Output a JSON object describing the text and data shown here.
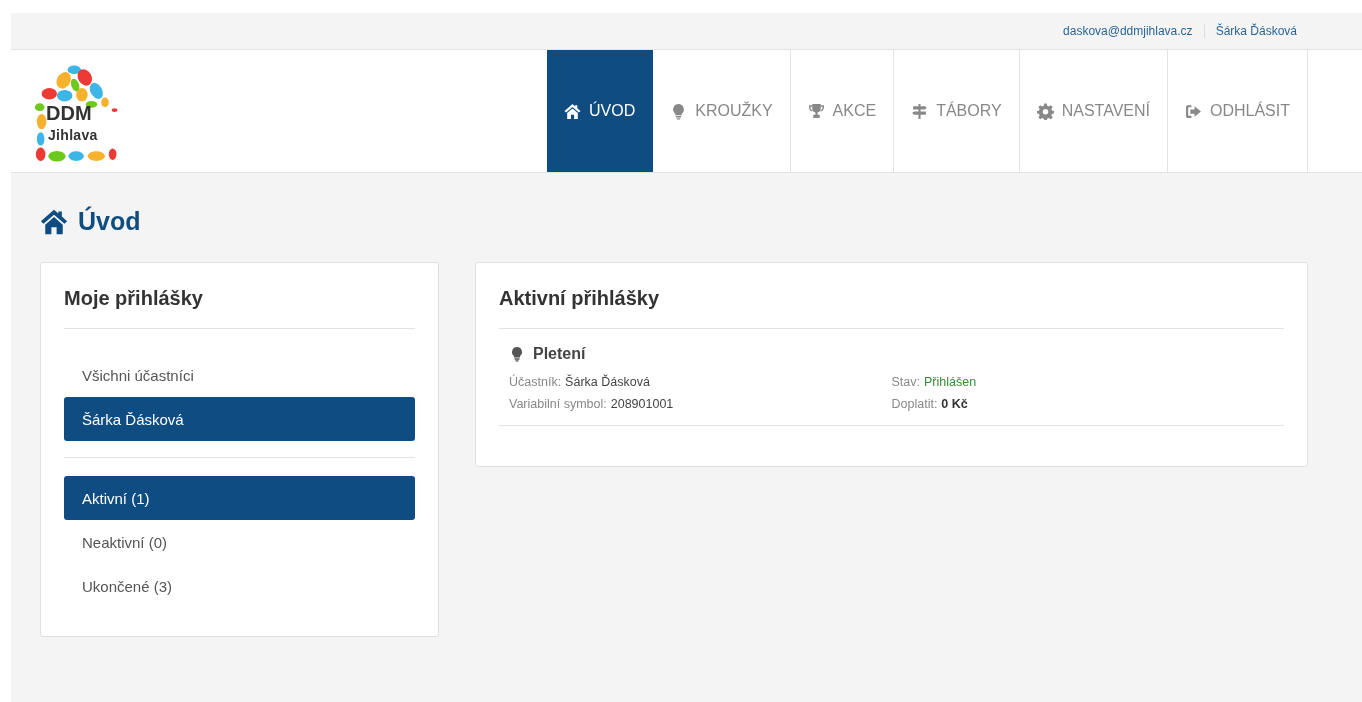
{
  "top_bar": {
    "email": "daskova@ddmjihlava.cz",
    "user": "Šárka Ďásková"
  },
  "logo": {
    "line_1": "DDM",
    "line_2": "Jihlava"
  },
  "nav": [
    {
      "label": "ÚVOD",
      "selected": true
    },
    {
      "label": "KROUŽKY",
      "selected": false
    },
    {
      "label": "AKCE",
      "selected": false
    },
    {
      "label": "TÁBORY",
      "selected": false
    },
    {
      "label": "NASTAVENÍ",
      "selected": false
    },
    {
      "label": "ODHLÁSIT",
      "selected": false
    }
  ],
  "page_title": "Úvod",
  "my_applications": {
    "title": "Moje přihlášky",
    "participants": [
      {
        "label": "Všichni účastníci",
        "selected": false
      },
      {
        "label": "Šárka Ďásková",
        "selected": true
      }
    ],
    "filters": [
      {
        "label": "Aktivní (1)",
        "selected": true
      },
      {
        "label": "Neaktivní (0)",
        "selected": false
      },
      {
        "label": "Ukončené (3)",
        "selected": false
      }
    ]
  },
  "active_applications": {
    "title": "Aktivní přihlášky",
    "items": [
      {
        "name": "Pletení",
        "fields": [
          {
            "label": "Účastník:",
            "value": "Šárka Ďásková",
            "kind": "plain"
          },
          {
            "label": "Stav:",
            "value": "Přihlášen",
            "kind": "status"
          },
          {
            "label": "Variabilní symbol:",
            "value": "208901001",
            "kind": "plain"
          },
          {
            "label": "Doplatit:",
            "value": "0 Kč",
            "kind": "amount"
          }
        ]
      }
    ]
  }
}
